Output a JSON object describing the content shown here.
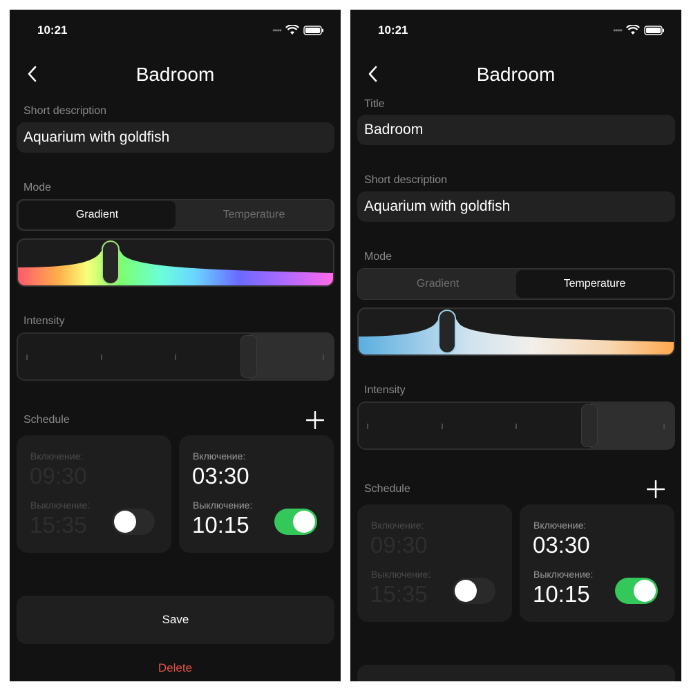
{
  "screen_left": {
    "time": "10:21",
    "title": "Badroom",
    "description_label": "Short description",
    "description_value": "Aquarium with goldfish",
    "mode_label": "Mode",
    "mode_options": [
      "Gradient",
      "Temperature"
    ],
    "mode_selected": "Gradient",
    "intensity_label": "Intensity",
    "intensity_level": 0.75,
    "schedule_label": "Schedule",
    "schedule": [
      {
        "on_label": "Включение:",
        "on_time": "09:30",
        "off_label": "Выключение:",
        "off_time": "15:35",
        "enabled": false
      },
      {
        "on_label": "Включение:",
        "on_time": "03:30",
        "off_label": "Выключение:",
        "off_time": "10:15",
        "enabled": true
      }
    ],
    "save_label": "Save",
    "delete_label": "Delete"
  },
  "screen_right": {
    "time": "10:21",
    "title": "Badroom",
    "title_label": "Title",
    "title_value": "Badroom",
    "description_label": "Short description",
    "description_value": "Aquarium with goldfish",
    "mode_label": "Mode",
    "mode_options": [
      "Gradient",
      "Temperature"
    ],
    "mode_selected": "Temperature",
    "intensity_label": "Intensity",
    "intensity_level": 0.75,
    "schedule_label": "Schedule",
    "schedule": [
      {
        "on_label": "Включение:",
        "on_time": "09:30",
        "off_label": "Выключение:",
        "off_time": "15:35",
        "enabled": false
      },
      {
        "on_label": "Включение:",
        "on_time": "03:30",
        "off_label": "Выключение:",
        "off_time": "10:15",
        "enabled": true
      }
    ]
  },
  "colors": {
    "background": "#121212",
    "surface": "#222222",
    "toggle_on": "#34c759",
    "delete": "#e2524a",
    "gradient_thumb": "#9ee67a",
    "temperature_thumb": "#9fd3ea"
  },
  "icons": [
    "back-chevron-icon",
    "wifi-icon",
    "battery-icon",
    "signal-dots-icon",
    "plus-icon"
  ]
}
